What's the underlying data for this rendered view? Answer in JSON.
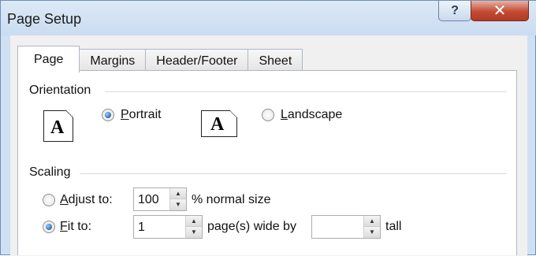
{
  "window": {
    "title": "Page Setup",
    "help_glyph": "?",
    "close_glyph": "✕"
  },
  "tabs": [
    {
      "label": "Page",
      "active": true
    },
    {
      "label": "Margins",
      "active": false
    },
    {
      "label": "Header/Footer",
      "active": false
    },
    {
      "label": "Sheet",
      "active": false
    }
  ],
  "orientation": {
    "label": "Orientation",
    "icon_letter": "A",
    "portrait": {
      "label": "Portrait",
      "checked": true
    },
    "landscape": {
      "label": "Landscape",
      "checked": false
    }
  },
  "scaling": {
    "label": "Scaling",
    "adjust": {
      "label": "Adjust to:",
      "value": "100",
      "suffix": "% normal size",
      "checked": false
    },
    "fit": {
      "label": "Fit to:",
      "wide_value": "1",
      "wide_suffix": "page(s) wide by",
      "tall_value": "",
      "tall_suffix": "tall",
      "checked": true
    }
  },
  "colors": {
    "titlebar": "#cadcf1",
    "close_button": "#c44a32",
    "panel": "#ffffff",
    "radio_selected": "#2a6bb4"
  }
}
